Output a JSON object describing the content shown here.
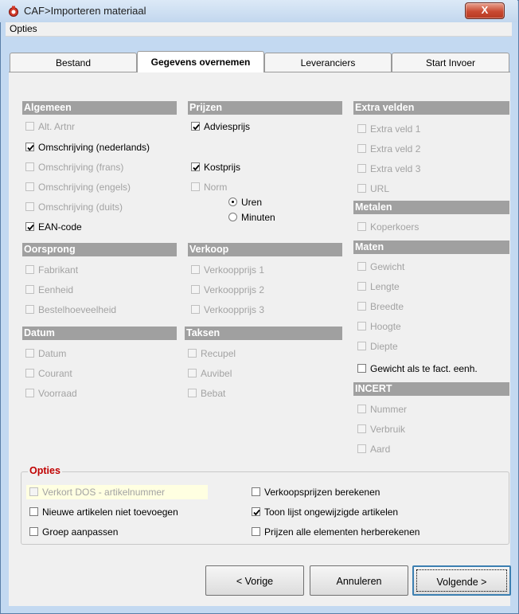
{
  "window": {
    "title": "CAF>Importeren materiaal",
    "close_label": "X"
  },
  "menu": {
    "opties": "Opties"
  },
  "tabs": [
    {
      "label": "Bestand",
      "active": false
    },
    {
      "label": "Gegevens overnemen",
      "active": true
    },
    {
      "label": "Leveranciers",
      "active": false
    },
    {
      "label": "Start Invoer",
      "active": false
    }
  ],
  "sections": {
    "algemeen": "Algemeen",
    "prijzen": "Prijzen",
    "extra_velden": "Extra velden",
    "metalen": "Metalen",
    "maten": "Maten",
    "oorsprong": "Oorsprong",
    "verkoop": "Verkoop",
    "datum": "Datum",
    "taksen": "Taksen",
    "incert": "INCERT"
  },
  "checkboxes": {
    "alt_artnr": "Alt. Artnr",
    "omschrijving_nl": "Omschrijving (nederlands)",
    "omschrijving_fr": "Omschrijving (frans)",
    "omschrijving_en": "Omschrijving (engels)",
    "omschrijving_de": "Omschrijving (duits)",
    "ean_code": "EAN-code",
    "adviesprijs": "Adviesprijs",
    "kostprijs": "Kostprijs",
    "norm": "Norm",
    "extra_veld_1": "Extra veld 1",
    "extra_veld_2": "Extra veld 2",
    "extra_veld_3": "Extra veld 3",
    "url": "URL",
    "koperkoers": "Koperkoers",
    "fabrikant": "Fabrikant",
    "eenheid": "Eenheid",
    "bestelhoeveelheid": "Bestelhoeveelheid",
    "verkoopprijs_1": "Verkoopprijs 1",
    "verkoopprijs_2": "Verkoopprijs 2",
    "verkoopprijs_3": "Verkoopprijs 3",
    "gewicht": "Gewicht",
    "lengte": "Lengte",
    "breedte": "Breedte",
    "hoogte": "Hoogte",
    "diepte": "Diepte",
    "gewicht_fact": "Gewicht als te fact. eenh.",
    "datum": "Datum",
    "courant": "Courant",
    "voorraad": "Voorraad",
    "recupel": "Recupel",
    "auvibel": "Auvibel",
    "bebat": "Bebat",
    "nummer": "Nummer",
    "verbruik": "Verbruik",
    "aard": "Aard"
  },
  "radios": {
    "uren": "Uren",
    "minuten": "Minuten",
    "selected": "Uren"
  },
  "options_group": {
    "title": "Opties",
    "verkort_dos": "Verkort DOS - artikelnummer",
    "nieuwe_artikelen": "Nieuwe artikelen niet toevoegen",
    "groep_aanpassen": "Groep aanpassen",
    "verkoopsprijzen": "Verkoopsprijzen berekenen",
    "toon_lijst": "Toon lijst ongewijzigde artikelen",
    "prijzen_alle": "Prijzen alle elementen herberekenen"
  },
  "buttons": {
    "vorige": "< Vorige",
    "annuleren": "Annuleren",
    "volgende": "Volgende >"
  },
  "colors": {
    "section_header": "#a0a0a0",
    "opties_title": "#c00000",
    "close_button": "#c94a31"
  }
}
